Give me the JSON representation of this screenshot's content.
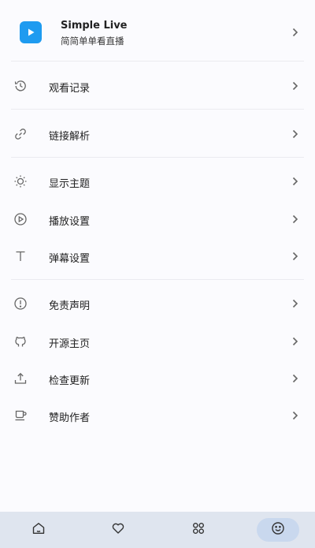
{
  "header": {
    "title": "Simple Live",
    "subtitle": "简简单单看直播"
  },
  "menu": {
    "history": "观看记录",
    "link_parse": "链接解析",
    "theme": "显示主题",
    "playback_settings": "播放设置",
    "danmaku_settings": "弹幕设置",
    "disclaimer": "免责声明",
    "open_source": "开源主页",
    "check_update": "检查更新",
    "sponsor": "赞助作者"
  },
  "navbar": {
    "items": [
      "home-icon",
      "heart-icon",
      "category-icon",
      "smile-icon"
    ],
    "active_index": 3
  },
  "colors": {
    "accent": "#1e9bf0",
    "navbar_bg": "#dfe5ef",
    "active_pill": "#c9d8ee"
  }
}
